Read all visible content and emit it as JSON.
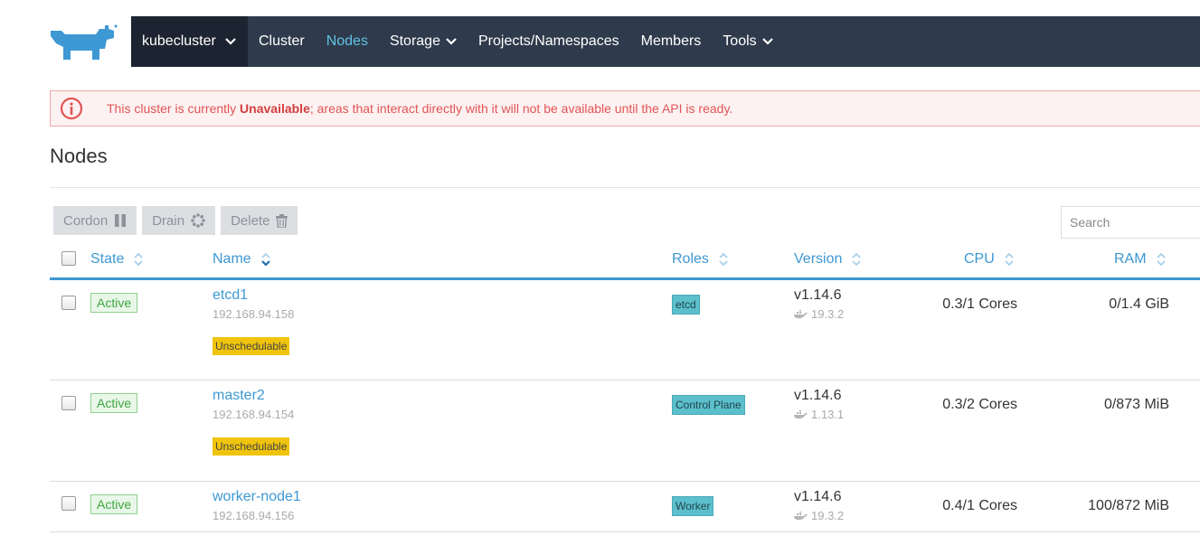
{
  "brand": {
    "logo_icon": "rancher-cow-logo-icon",
    "logo_color": "#3d98d3"
  },
  "nav": {
    "cluster_switcher": "kubecluster",
    "items": [
      {
        "label": "Cluster",
        "has_dropdown": false,
        "active": false
      },
      {
        "label": "Nodes",
        "has_dropdown": false,
        "active": true
      },
      {
        "label": "Storage",
        "has_dropdown": true,
        "active": false
      },
      {
        "label": "Projects/Namespaces",
        "has_dropdown": false,
        "active": false
      },
      {
        "label": "Members",
        "has_dropdown": false,
        "active": false
      },
      {
        "label": "Tools",
        "has_dropdown": true,
        "active": false
      }
    ],
    "background": "#2f3b4c",
    "active_color": "#5fc3e4"
  },
  "alert": {
    "icon": "info-circle-icon",
    "text_before": "This cluster is currently ",
    "text_bold": "Unavailable",
    "text_after": "; areas that interact directly with it will not be available until the API is ready."
  },
  "page": {
    "title": "Nodes"
  },
  "bulk_actions": {
    "cordon": {
      "label": "Cordon",
      "icon": "pause-icon"
    },
    "drain": {
      "label": "Drain",
      "icon": "spinner-icon"
    },
    "delete": {
      "label": "Delete",
      "icon": "trash-icon"
    }
  },
  "search": {
    "placeholder": "Search",
    "value": ""
  },
  "table": {
    "headers": {
      "state": "State",
      "name": "Name",
      "roles": "Roles",
      "version": "Version",
      "cpu": "CPU",
      "ram": "RAM"
    },
    "rows": [
      {
        "state": "Active",
        "name": "etcd1",
        "ip": "192.168.94.158",
        "unschedulable": "Unschedulable",
        "role": "etcd",
        "version": "v1.14.6",
        "docker_version": "19.3.2",
        "cpu": "0.3/1 Cores",
        "ram": "0/1.4 GiB"
      },
      {
        "state": "Active",
        "name": "master2",
        "ip": "192.168.94.154",
        "unschedulable": "Unschedulable",
        "role": "Control Plane",
        "version": "v1.14.6",
        "docker_version": "1.13.1",
        "cpu": "0.3/2 Cores",
        "ram": "0/873 MiB"
      },
      {
        "state": "Active",
        "name": "worker-node1",
        "ip": "192.168.94.156",
        "unschedulable": null,
        "role": "Worker",
        "version": "v1.14.6",
        "docker_version": "19.3.2",
        "cpu": "0.4/1 Cores",
        "ram": "100/872 MiB"
      }
    ]
  }
}
